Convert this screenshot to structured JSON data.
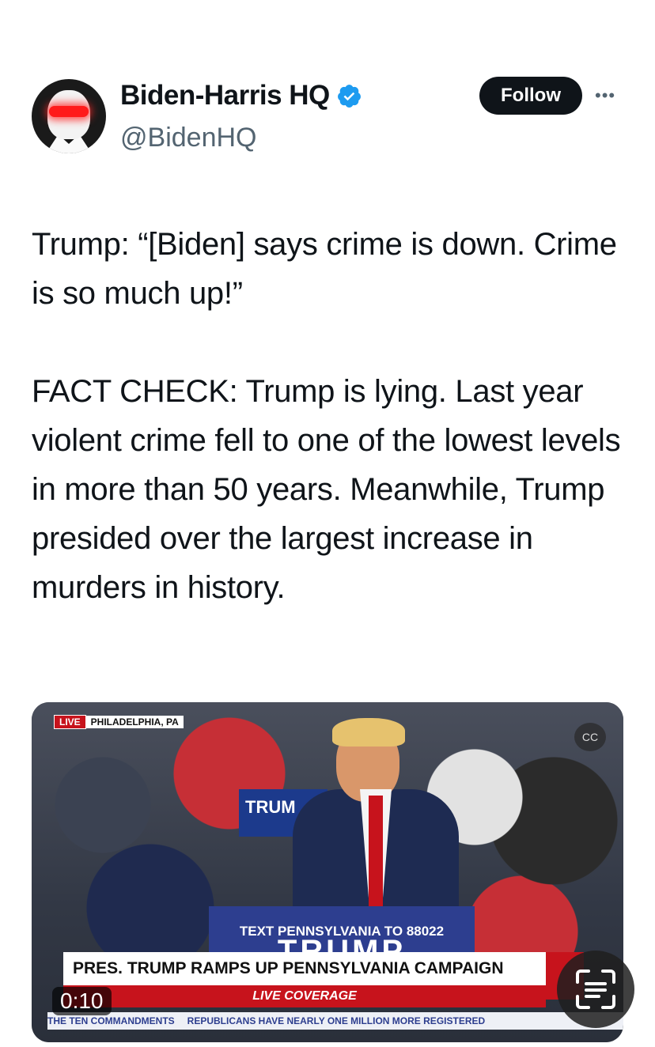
{
  "account": {
    "name": "Biden-Harris HQ",
    "handle": "@BidenHQ",
    "follow_label": "Follow",
    "more_icon": "more-horizontal-icon",
    "verified_icon": "verified-badge-icon",
    "verified_color": "#1d9bf0"
  },
  "tweet": {
    "paragraph1": "Trump: “[Biden] says crime is down. Crime is so much up!”",
    "paragraph2": "FACT CHECK: Trump is lying. Last year violent crime fell to one of the lowest levels in more than 50 years. Meanwhile, Trump presided over the largest increase in murders in history."
  },
  "video": {
    "live_label": "LIVE",
    "location": "PHILADELPHIA, PA",
    "sign_text": "TRUM",
    "podium_line1": "TEXT PENNSYLVANIA TO 88022",
    "podium_line2": "TRUMP",
    "chyron_headline": "PRES. TRUMP RAMPS UP PENNSYLVANIA CAMPAIGN",
    "chyron_sub": "LIVE COVERAGE",
    "ticker_left": "THE TEN COMMANDMENTS",
    "ticker_right": "REPUBLICANS HAVE NEARLY ONE MILLION MORE REGISTERED",
    "timestamp": "0:10",
    "captions_icon": "closed-captions-icon"
  },
  "overlay": {
    "scan_icon": "scan-text-icon"
  }
}
